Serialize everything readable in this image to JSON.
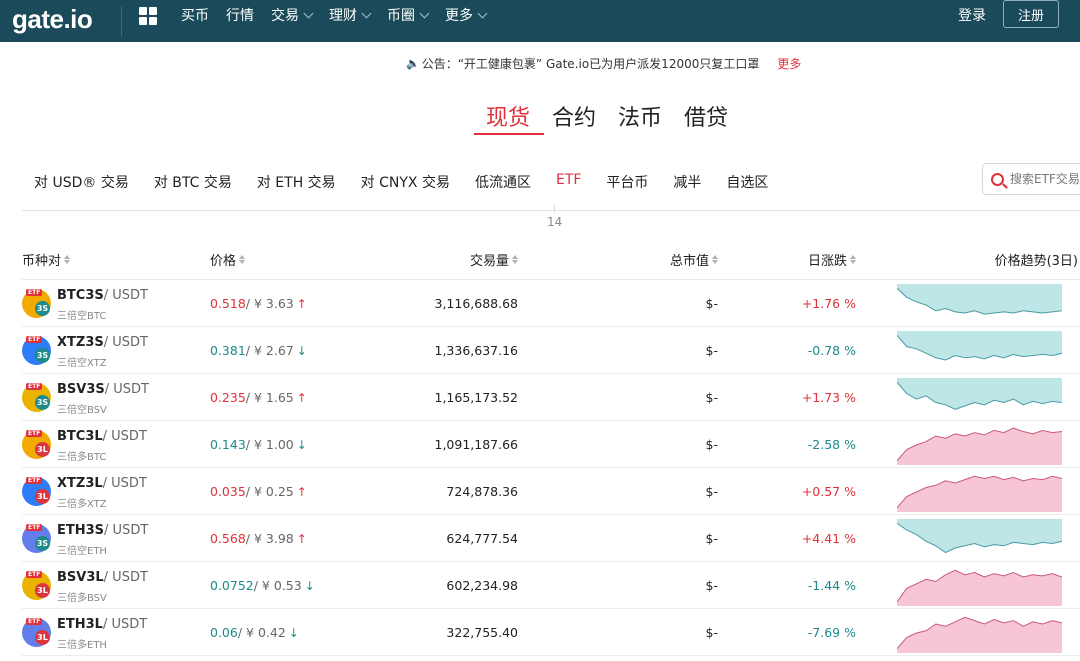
{
  "header": {
    "logo": "gate.io",
    "nav": [
      {
        "label": "买币",
        "dropdown": false
      },
      {
        "label": "行情",
        "dropdown": false
      },
      {
        "label": "交易",
        "dropdown": true
      },
      {
        "label": "理财",
        "dropdown": true
      },
      {
        "label": "币圈",
        "dropdown": true
      },
      {
        "label": "更多",
        "dropdown": true
      }
    ],
    "login": "登录",
    "signup": "注册",
    "colors": {
      "bg": "#1b4b5a"
    }
  },
  "announcement": {
    "text": "公告：“开工健康包裹” Gate.io已为用户派发12000只复工口罩",
    "more": "更多"
  },
  "main_tabs": [
    "现货",
    "合约",
    "法币",
    "借贷"
  ],
  "main_tab_active": 0,
  "sub_tabs": [
    "对 USD® 交易",
    "对 BTC 交易",
    "对 ETH 交易",
    "对 CNYX 交易",
    "低流通区",
    "ETF",
    "平台币",
    "减半",
    "自选区"
  ],
  "sub_tab_active": 5,
  "etf_count": "14",
  "search": {
    "placeholder": "搜索ETF交易"
  },
  "table": {
    "headers": {
      "pair": "币种对",
      "price": "价格",
      "volume": "交易量",
      "market_cap": "总市值",
      "change": "日涨跌",
      "trend": "价格趋势(3日)"
    },
    "rows": [
      {
        "base": "BTC3S",
        "quote": "/ USDT",
        "name": "三倍空BTC",
        "price": "0.518",
        "cny": "/ ¥ 3.63",
        "dir": "up",
        "volume": "3,116,688.68",
        "mcap": "$-",
        "change": "+1.76 %",
        "icon": "btc-3s",
        "trend": [
          30,
          22,
          18,
          15,
          10,
          12,
          9,
          8,
          10,
          7,
          8,
          9,
          8,
          10,
          9,
          8,
          9,
          10
        ]
      },
      {
        "base": "XTZ3S",
        "quote": "/ USDT",
        "name": "三倍空XTZ",
        "price": "0.381",
        "cny": "/ ¥ 2.67",
        "dir": "down",
        "volume": "1,336,637.16",
        "mcap": "$-",
        "change": "-0.78 %",
        "icon": "xtz-3s",
        "trend": [
          30,
          20,
          18,
          14,
          10,
          8,
          12,
          10,
          11,
          9,
          12,
          10,
          13,
          11,
          12,
          13,
          12,
          14
        ]
      },
      {
        "base": "BSV3S",
        "quote": "/ USDT",
        "name": "三倍空BSV",
        "price": "0.235",
        "cny": "/ ¥ 1.65",
        "dir": "up",
        "volume": "1,165,173.52",
        "mcap": "$-",
        "change": "+1.73 %",
        "icon": "bsv-3s",
        "trend": [
          30,
          20,
          15,
          18,
          12,
          10,
          6,
          9,
          12,
          10,
          14,
          12,
          15,
          10,
          13,
          11,
          13,
          12
        ]
      },
      {
        "base": "BTC3L",
        "quote": "/ USDT",
        "name": "三倍多BTC",
        "price": "0.143",
        "cny": "/ ¥ 1.00",
        "dir": "down",
        "volume": "1,091,187.66",
        "mcap": "$-",
        "change": "-2.58 %",
        "icon": "btc-3l",
        "trend": [
          2,
          12,
          16,
          19,
          24,
          22,
          26,
          24,
          27,
          25,
          29,
          27,
          31,
          28,
          26,
          29,
          27,
          28
        ]
      },
      {
        "base": "XTZ3L",
        "quote": "/ USDT",
        "name": "三倍多XTZ",
        "price": "0.035",
        "cny": "/ ¥ 0.25",
        "dir": "up",
        "volume": "724,878.36",
        "mcap": "$-",
        "change": "+0.57 %",
        "icon": "xtz-3l",
        "trend": [
          2,
          12,
          16,
          20,
          22,
          26,
          24,
          27,
          30,
          28,
          30,
          27,
          29,
          26,
          28,
          27,
          30,
          28
        ]
      },
      {
        "base": "ETH3S",
        "quote": "/ USDT",
        "name": "三倍空ETH",
        "price": "0.568",
        "cny": "/ ¥ 3.98",
        "dir": "up",
        "volume": "624,777.54",
        "mcap": "$-",
        "change": "+4.41 %",
        "icon": "eth-3s",
        "trend": [
          30,
          24,
          20,
          14,
          10,
          4,
          8,
          10,
          12,
          9,
          11,
          10,
          13,
          12,
          11,
          13,
          12,
          14
        ]
      },
      {
        "base": "BSV3L",
        "quote": "/ USDT",
        "name": "三倍多BSV",
        "price": "0.0752",
        "cny": "/ ¥ 0.53",
        "dir": "down",
        "volume": "602,234.98",
        "mcap": "$-",
        "change": "-1.44 %",
        "icon": "bsv-3l",
        "trend": [
          2,
          14,
          18,
          22,
          20,
          26,
          30,
          26,
          28,
          24,
          27,
          25,
          28,
          24,
          26,
          25,
          27,
          24
        ]
      },
      {
        "base": "ETH3L",
        "quote": "/ USDT",
        "name": "三倍多ETH",
        "price": "0.06",
        "cny": "/ ¥ 0.42",
        "dir": "down",
        "volume": "322,755.40",
        "mcap": "$-",
        "change": "-7.69 %",
        "icon": "eth-3l",
        "trend": [
          2,
          12,
          16,
          18,
          24,
          22,
          26,
          30,
          27,
          24,
          28,
          25,
          27,
          22,
          26,
          24,
          27,
          25
        ]
      }
    ]
  },
  "colors": {
    "up": "#e0313c",
    "down": "#1e8a8a",
    "short_fill": "#bfe6e6",
    "short_line": "#4a9aa6",
    "long_fill": "#f6c6d4",
    "long_line": "#c95a7a"
  }
}
